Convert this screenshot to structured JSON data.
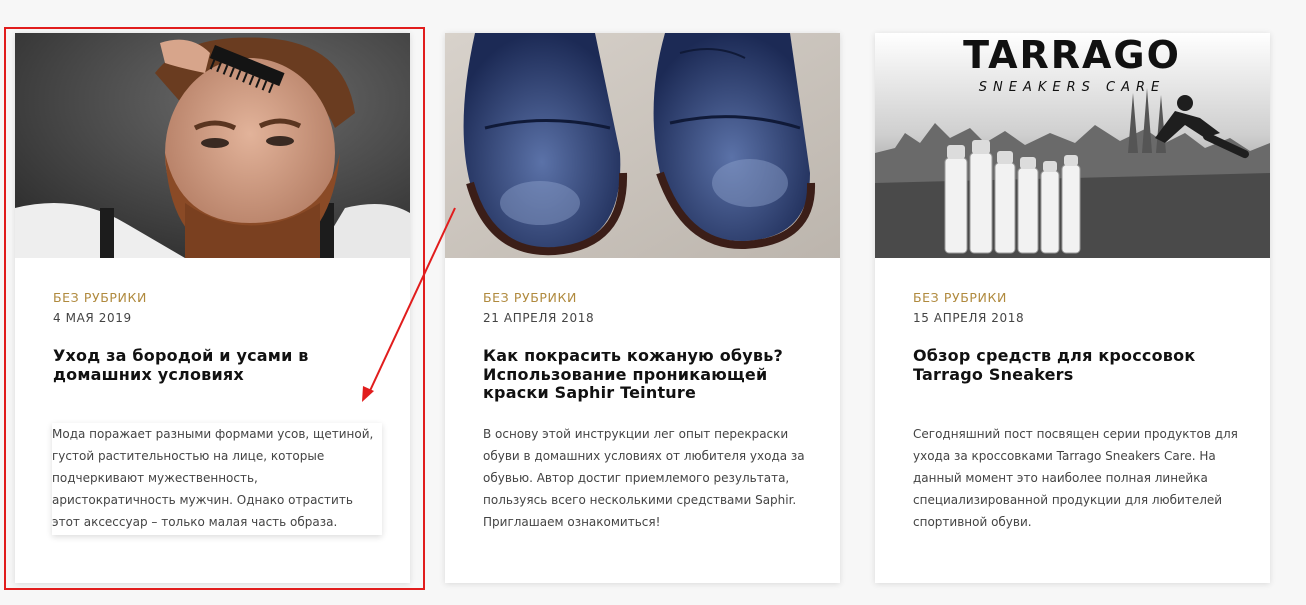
{
  "posts": [
    {
      "category": "Без рубрики",
      "date": "4 мая 2019",
      "title": "Уход за бородой и усами в домашних условиях",
      "excerpt": "Мода поражает разными формами усов, щетиной, густой растительностью на лице, которые подчеркивают мужественность, аристократичность мужчин. Однако отрастить этот аксессуар – только малая часть образа. Истинный джентльмен знает,"
    },
    {
      "category": "Без рубрики",
      "date": "21 апреля 2018",
      "title": "Как покрасить кожаную обувь? Использование проникающей краски Saphir Teinture",
      "excerpt": "В основу этой инструкции лег опыт перекраски обуви в домашних условиях от любителя ухода за обувью. Автор достиг приемлемого результата, пользуясь всего несколькими средствами Saphir. Приглашаем ознакомиться!"
    },
    {
      "category": "Без рубрики",
      "date": "15 апреля 2018",
      "title": "Обзор средств для кроссовок Tarrago Sneakers",
      "excerpt": "Сегодняшний пост посвящен серии продуктов для ухода за кроссовками Tarrago Sneakers Care. На данный момент это наиболее полная линейка специализированной продукции для любителей спортивной обуви."
    }
  ],
  "brand": {
    "logo_main": "TARRAGO",
    "logo_sub": "SNEAKERS CARE"
  },
  "colors": {
    "category": "#b08a3e",
    "annotation": "#e11d1d",
    "background": "#f7f7f7"
  }
}
